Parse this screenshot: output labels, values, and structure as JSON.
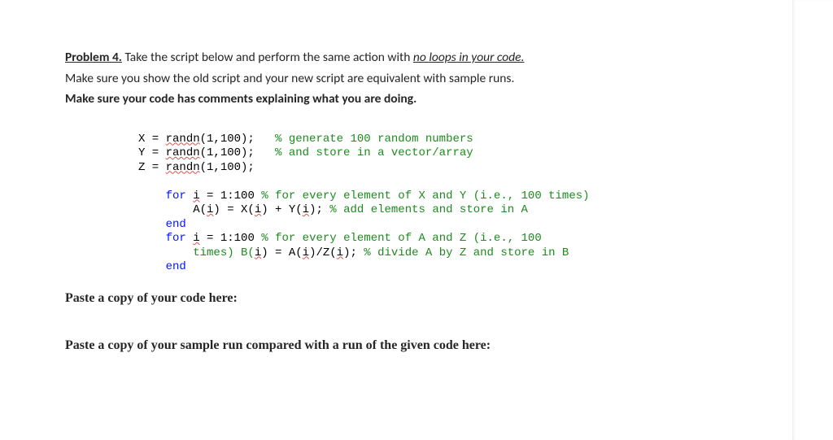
{
  "problem": {
    "label": "Problem 4.",
    "line1_rest": " Take the script below and perform the same action with ",
    "no_loops": "no loops in your code.",
    "line2": "Make sure you show the old script and your new script are equivalent with sample runs.",
    "line3": "Make sure your code has comments explaining what you are doing."
  },
  "code": {
    "l1a": "X = ",
    "l1b": "randn",
    "l1c": "(1,100);",
    "l1d": "   % generate 100 random numbers",
    "l2a": "Y = ",
    "l2b": "randn",
    "l2c": "(1,100);",
    "l2d": "   % and store in a vector/array",
    "l3a": "Z = ",
    "l3b": "randn",
    "l3c": "(1,100);",
    "l4a": "    ",
    "l4b": "for",
    "l4c": " ",
    "l4d": "i",
    "l4e": " = 1:100 ",
    "l4f": "% for every element of X and Y (i.e., 100 times)",
    "l5a": "        A(",
    "l5b": "i",
    "l5c": ") = X(",
    "l5d": "i",
    "l5e": ") + Y(",
    "l5f": "i",
    "l5g": "); ",
    "l5h": "% add elements and store in A",
    "l6a": "    ",
    "l6b": "end",
    "l7a": "    ",
    "l7b": "for",
    "l7c": " ",
    "l7d": "i",
    "l7e": " = 1:100 ",
    "l7f": "% for every element of A and Z (i.e., 100",
    "l8a": "        times) B(",
    "l8b": "i",
    "l8c": ") = A(",
    "l8d": "i",
    "l8e": ")/Z(",
    "l8f": "i",
    "l8g": "); ",
    "l8h": "% divide A by Z and store in B",
    "l9a": "    ",
    "l9b": "end"
  },
  "paste": {
    "code_label": "Paste a copy of your code here:",
    "run_label": "Paste a copy of your sample run compared with a run of the given code here:"
  }
}
